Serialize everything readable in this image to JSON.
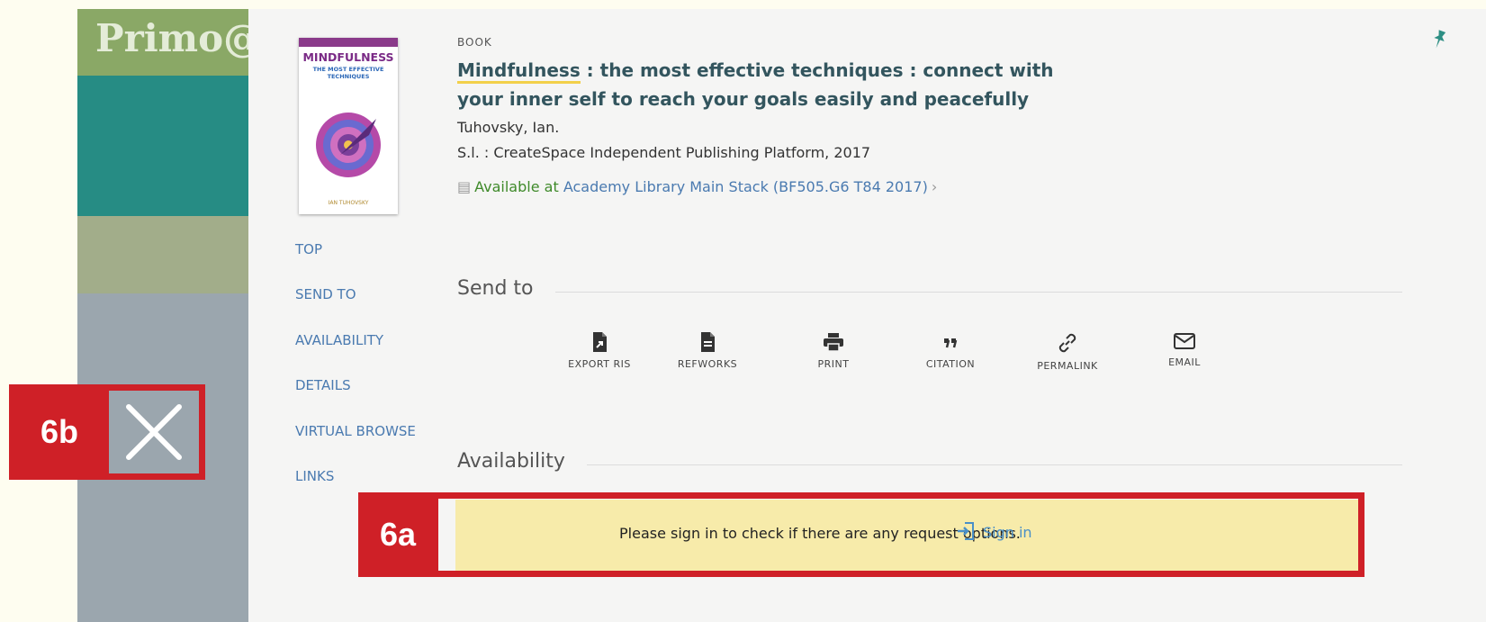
{
  "background_app": {
    "logo_text": "Primo@"
  },
  "record": {
    "type": "BOOK",
    "title_highlight": "Mindfulness",
    "title_rest": " : the most effective techniques : connect with your inner self to reach your goals easily and peacefully",
    "author": "Tuhovsky, Ian.",
    "publisher": "S.l. : CreateSpace Independent Publishing Platform, 2017",
    "availability_status": "Available at",
    "availability_location": "Academy Library  Main Stack (BF505.G6 T84 2017)",
    "cover": {
      "title": "MINDFULNESS",
      "subtitle": "THE MOST EFFECTIVE TECHNIQUES",
      "author": "IAN TUHOVSKY"
    }
  },
  "nav": {
    "items": [
      {
        "label": "TOP"
      },
      {
        "label": "SEND TO"
      },
      {
        "label": "AVAILABILITY"
      },
      {
        "label": "DETAILS"
      },
      {
        "label": "VIRTUAL BROWSE"
      },
      {
        "label": "LINKS"
      }
    ]
  },
  "send_to": {
    "heading": "Send to",
    "actions": [
      {
        "label": "EXPORT RIS",
        "icon": "export-ris-icon"
      },
      {
        "label": "REFWORKS",
        "icon": "refworks-icon"
      },
      {
        "label": "PRINT",
        "icon": "print-icon"
      },
      {
        "label": "CITATION",
        "icon": "citation-icon"
      },
      {
        "label": "PERMALINK",
        "icon": "permalink-icon"
      },
      {
        "label": "EMAIL",
        "icon": "email-icon"
      }
    ]
  },
  "availability": {
    "heading": "Availability",
    "message": "Please sign in to check if there are any request options.",
    "signin_label": "Sign in"
  },
  "annotations": {
    "tag_a": "6a",
    "tag_b": "6b"
  },
  "colors": {
    "accent_red": "#cf2027",
    "link_blue": "#4a7ab0",
    "available_green": "#3f8a2a",
    "notice_yellow": "#f7ebaa"
  }
}
